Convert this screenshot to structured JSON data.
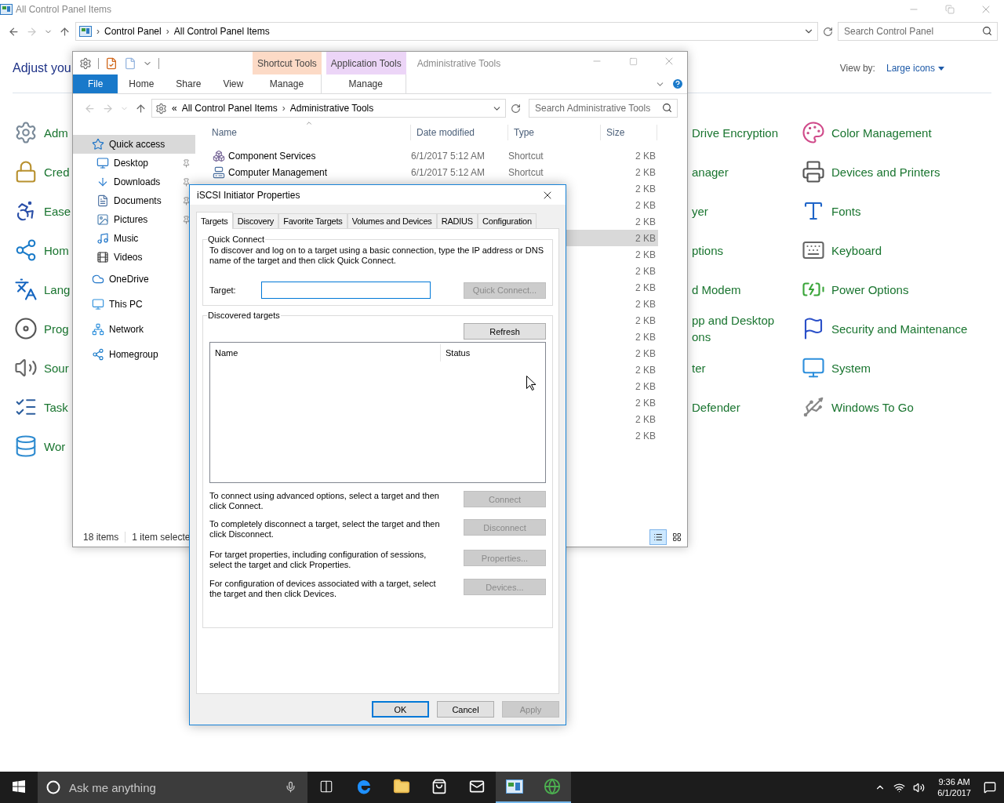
{
  "control_panel": {
    "title": "All Control Panel Items",
    "breadcrumb": [
      "Control Panel",
      "All Control Panel Items"
    ],
    "separator": "›",
    "search": {
      "placeholder": "Search Control Panel"
    },
    "heading": "Adjust you",
    "view_by": {
      "label": "View by:",
      "value": "Large icons"
    },
    "columns": [
      {
        "items": [
          {
            "label": "Adm"
          },
          {
            "label": "Cred"
          },
          {
            "label": "Ease"
          },
          {
            "label": "Hom"
          },
          {
            "label": "Lang"
          },
          {
            "label": "Prog"
          },
          {
            "label": "Sour"
          },
          {
            "label": "Task"
          },
          {
            "label": "Wor"
          }
        ]
      },
      {
        "items": [
          {
            "label": "Drive Encryption"
          },
          {
            "label": "anager"
          },
          {
            "label": "yer"
          },
          {
            "label": "ptions"
          },
          {
            "label": "d Modem"
          },
          {
            "label": "pp and Desktop\nons"
          },
          {
            "label": "ter"
          },
          {
            "label": "Defender"
          }
        ]
      },
      {
        "items": [
          {
            "label": "Color Management"
          },
          {
            "label": "Devices and Printers"
          },
          {
            "label": "Fonts"
          },
          {
            "label": "Keyboard"
          },
          {
            "label": "Power Options"
          },
          {
            "label": "Security and Maintenance"
          },
          {
            "label": "System"
          },
          {
            "label": "Windows To Go"
          }
        ]
      }
    ]
  },
  "explorer": {
    "title": "Administrative Tools",
    "context_tabs": [
      {
        "header": "Shortcut Tools",
        "tab": "Manage",
        "color": "#fcdac6"
      },
      {
        "header": "Application Tools",
        "tab": "Manage",
        "color": "#ecd5f7"
      }
    ],
    "ribbon_tabs": [
      {
        "label": "File",
        "kind": "file"
      },
      {
        "label": "Home",
        "kind": "tab"
      },
      {
        "label": "Share",
        "kind": "tab"
      },
      {
        "label": "View",
        "kind": "tab"
      }
    ],
    "address": {
      "prefix": "«",
      "separator": "›",
      "breadcrumb": [
        "All Control Panel Items",
        "Administrative Tools"
      ]
    },
    "search": {
      "placeholder": "Search Administrative Tools"
    },
    "nav": [
      {
        "label": "Quick access",
        "selected": true,
        "children": [
          {
            "label": "Desktop",
            "pinned": true,
            "selected": false
          },
          {
            "label": "Downloads",
            "pinned": true,
            "selected": false
          },
          {
            "label": "Documents",
            "pinned": true,
            "selected": false
          },
          {
            "label": "Pictures",
            "pinned": true,
            "selected": false
          },
          {
            "label": "Music",
            "pinned": false,
            "selected": false
          },
          {
            "label": "Videos",
            "pinned": false,
            "selected": false
          }
        ]
      },
      {
        "label": "OneDrive",
        "selected": false
      },
      {
        "label": "This PC",
        "selected": false
      },
      {
        "label": "Network",
        "selected": false
      },
      {
        "label": "Homegroup",
        "selected": false
      }
    ],
    "columns": [
      "Name",
      "Date modified",
      "Type",
      "Size"
    ],
    "rows": [
      {
        "name": "Component Services",
        "date": "6/1/2017 5:12 AM",
        "type": "Shortcut",
        "size": "2 KB",
        "selected": false
      },
      {
        "name": "Computer Management",
        "date": "6/1/2017 5:12 AM",
        "type": "Shortcut",
        "size": "2 KB",
        "selected": false
      },
      {
        "size": "2 KB",
        "selected": false
      },
      {
        "size": "2 KB",
        "selected": false
      },
      {
        "size": "2 KB",
        "selected": false
      },
      {
        "size": "2 KB",
        "selected": true
      },
      {
        "size": "2 KB",
        "selected": false
      },
      {
        "size": "2 KB",
        "selected": false
      },
      {
        "size": "2 KB",
        "selected": false
      },
      {
        "size": "2 KB",
        "selected": false
      },
      {
        "size": "2 KB",
        "selected": false
      },
      {
        "size": "2 KB",
        "selected": false
      },
      {
        "size": "2 KB",
        "selected": false
      },
      {
        "size": "2 KB",
        "selected": false
      },
      {
        "size": "2 KB",
        "selected": false
      },
      {
        "size": "2 KB",
        "selected": false
      },
      {
        "size": "2 KB",
        "selected": false
      },
      {
        "size": "2 KB",
        "selected": false
      }
    ],
    "status": [
      "18 items",
      "1 item selecte"
    ],
    "view_buttons": [
      {
        "selected": true
      },
      {
        "selected": false
      }
    ]
  },
  "dialog": {
    "title": "iSCSI Initiator Properties",
    "tabs": [
      {
        "label": "Targets",
        "selected": true
      },
      {
        "label": "Discovery",
        "selected": false
      },
      {
        "label": "Favorite Targets",
        "selected": false
      },
      {
        "label": "Volumes and Devices",
        "selected": false
      },
      {
        "label": "RADIUS",
        "selected": false
      },
      {
        "label": "Configuration",
        "selected": false
      }
    ],
    "quick_connect": {
      "legend": "Quick Connect",
      "description": "To discover and log on to a target using a basic connection, type the IP address or DNS name of the target and then click Quick Connect.",
      "target_label": "Target:",
      "button": {
        "label": "Quick Connect...",
        "disabled": true
      }
    },
    "discovered": {
      "legend": "Discovered targets",
      "refresh": {
        "label": "Refresh",
        "disabled": false
      },
      "columns": [
        "Name",
        "Status"
      ],
      "actions": [
        {
          "text": "To connect using advanced options, select a target and then click Connect.",
          "button": {
            "label": "Connect",
            "disabled": true
          }
        },
        {
          "text": "To completely disconnect a target, select the target and then click Disconnect.",
          "button": {
            "label": "Disconnect",
            "disabled": true
          }
        },
        {
          "text": "For target properties, including configuration of sessions, select the target and click Properties.",
          "button": {
            "label": "Properties...",
            "disabled": true
          }
        },
        {
          "text": "For configuration of devices associated with a target, select the target and then click Devices.",
          "button": {
            "label": "Devices...",
            "disabled": true
          }
        }
      ]
    },
    "buttons": [
      {
        "label": "OK",
        "default": true,
        "disabled": false
      },
      {
        "label": "Cancel",
        "default": false,
        "disabled": false
      },
      {
        "label": "Apply",
        "default": false,
        "disabled": true
      }
    ]
  },
  "taskbar": {
    "search": {
      "placeholder": "Ask me anything"
    },
    "apps": [
      {
        "active": false
      },
      {
        "active": false
      },
      {
        "active": false
      },
      {
        "active": false
      },
      {
        "active": false
      },
      {
        "active": true
      },
      {
        "active": true
      }
    ],
    "clock": {
      "time": "9:36 AM",
      "date": "6/1/2017"
    }
  }
}
